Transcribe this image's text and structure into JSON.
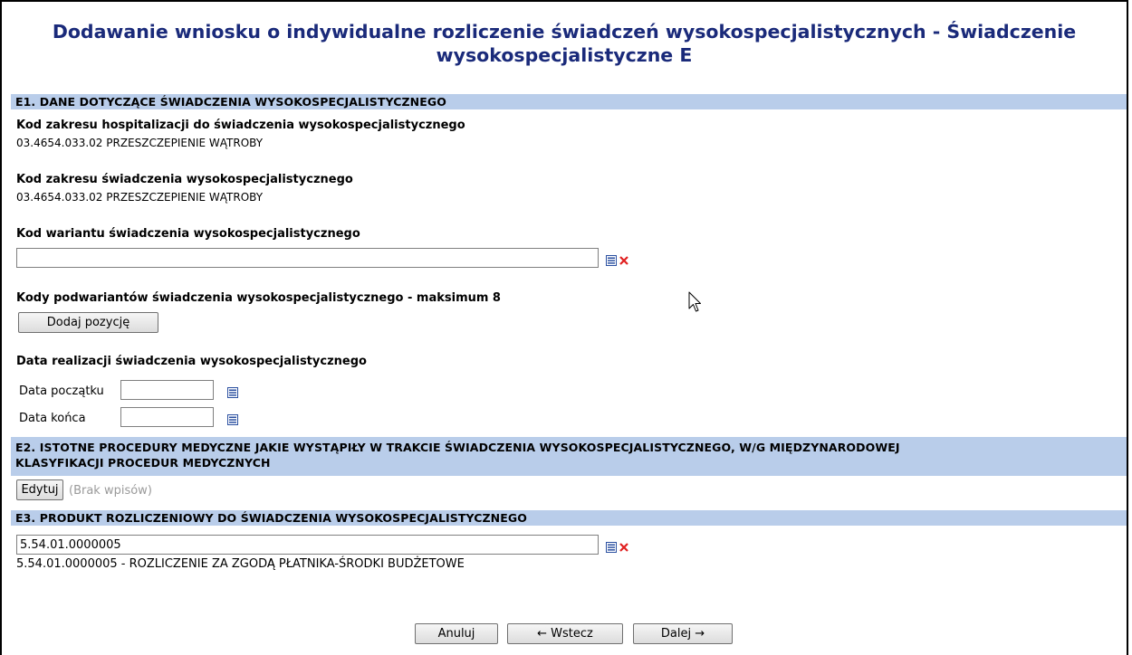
{
  "page": {
    "title_line1": "Dodawanie wniosku o indywidualne rozliczenie świadczeń wysokospecjalistycznych - Świadczenie",
    "title_line2": "wysokospecjalistyczne E"
  },
  "section_e1": {
    "header": "E1. DANE DOTYCZĄCE ŚWIADCZENIA WYSOKOSPECJALISTYCZNEGO",
    "hosp_label": "Kod zakresu hospitalizacji do świadczenia wysokospecjalistycznego",
    "hosp_value": "03.4654.033.02 PRZESZCZEPIENIE WĄTROBY",
    "scope_label": "Kod zakresu świadczenia wysokospecjalistycznego",
    "scope_value": "03.4654.033.02 PRZESZCZEPIENIE WĄTROBY",
    "variant_label": "Kod wariantu świadczenia wysokospecjalistycznego",
    "variant_value": "",
    "subvariants_label": "Kody podwariantów świadczenia wysokospecjalistycznego - maksimum 8",
    "add_button": "Dodaj pozycję",
    "date_label": "Data realizacji świadczenia wysokospecjalistycznego",
    "start_label": "Data początku",
    "start_value": "",
    "end_label": "Data końca",
    "end_value": ""
  },
  "section_e2": {
    "header_line1": "E2. ISTOTNE PROCEDURY MEDYCZNE JAKIE WYSTĄPIŁY W TRAKCIE ŚWIADCZENIA WYSOKOSPECJALISTYCZNEGO, W/G MIĘDZYNARODOWEJ",
    "header_line2": "KLASYFIKACJI PROCEDUR MEDYCZNYCH",
    "edit_button": "Edytuj",
    "empty_note": "(Brak wpisów)"
  },
  "section_e3": {
    "header": "E3. PRODUKT ROZLICZENIOWY DO ŚWIADCZENIA WYSOKOSPECJALISTYCZNEGO",
    "product_value": "5.54.01.0000005",
    "product_description": "5.54.01.0000005 - ROZLICZENIE ZA ZGODĄ PŁATNIKA-ŚRODKI BUDŻETOWE"
  },
  "footer": {
    "cancel_button": "Anuluj",
    "back_button": "← Wstecz",
    "next_button": "Dalej →"
  },
  "icons": {
    "list_icon": "list-picker-icon",
    "clear_icon": "clear-x-icon",
    "calendar_icon": "calendar-icon",
    "cursor": "mouse-pointer-icon"
  },
  "colors": {
    "title": "#1a2a7a",
    "section_header_bg": "#b9cdea",
    "clear_x": "#e02020",
    "list_icon_blue": "#2a4fa0"
  }
}
